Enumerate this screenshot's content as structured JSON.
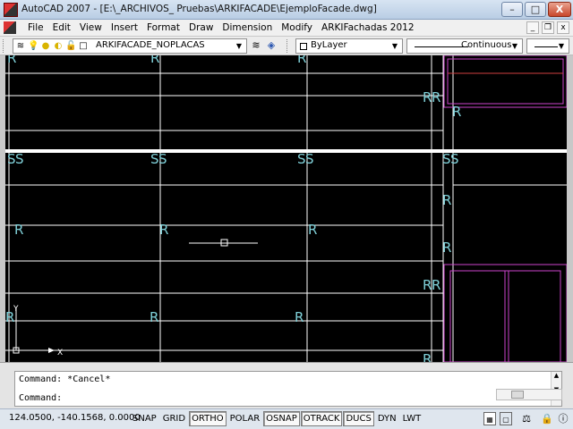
{
  "window": {
    "title": "AutoCAD 2007 - [E:\\_ARCHIVOS_ Pruebas\\ARKIFACADE\\EjemploFacade.dwg]",
    "buttons": {
      "minimize": "–",
      "maximize": "□",
      "close": "X"
    }
  },
  "menu": {
    "items": [
      "File",
      "Edit",
      "View",
      "Insert",
      "Format",
      "Draw",
      "Dimension",
      "Modify",
      "ARKIFachadas 2012"
    ],
    "doc_buttons": {
      "minimize": "_",
      "restore": "❐",
      "close": "x"
    }
  },
  "toolbar": {
    "layer_name": "ARKIFACADE_NOPLACAS",
    "color": "ByLayer",
    "linetype": "Continuous"
  },
  "drawing": {
    "background": "#000000",
    "line_color": "#ffffff",
    "label_color": "#7fd0d8",
    "accent_color": "#cc44cc",
    "labels": {
      "r": "R",
      "s": "S",
      "y": "Y",
      "x": "X"
    }
  },
  "command": {
    "line1": "Command: *Cancel*",
    "line2": "Command:"
  },
  "status": {
    "coordinates": "124.0500, -140.1568, 0.0000",
    "toggles": [
      {
        "label": "SNAP",
        "on": false
      },
      {
        "label": "GRID",
        "on": false
      },
      {
        "label": "ORTHO",
        "on": true
      },
      {
        "label": "POLAR",
        "on": false
      },
      {
        "label": "OSNAP",
        "on": true
      },
      {
        "label": "OTRACK",
        "on": true
      },
      {
        "label": "DUCS",
        "on": true
      },
      {
        "label": "DYN",
        "on": false
      },
      {
        "label": "LWT",
        "on": false
      }
    ]
  }
}
